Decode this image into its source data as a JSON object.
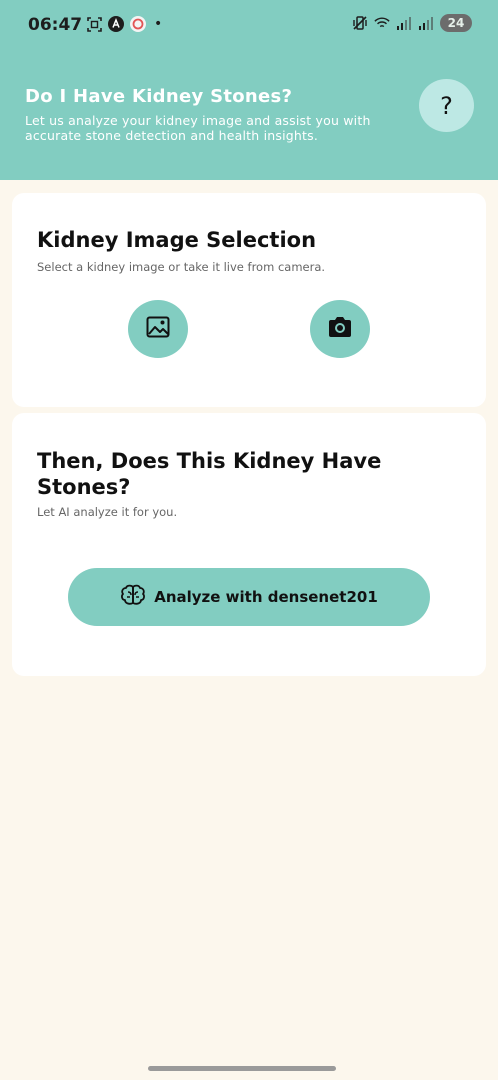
{
  "status_bar": {
    "time": "06:47",
    "battery": "24",
    "dot": "•"
  },
  "header": {
    "title": "Do I Have Kidney Stones?",
    "subtitle": "Let us analyze your kidney image and assist you with accurate stone detection and health insights.",
    "help_label": "?"
  },
  "selection_card": {
    "title": "Kidney Image Selection",
    "subtitle": "Select a kidney image or take it live from camera.",
    "gallery_icon": "image-icon",
    "camera_icon": "camera-icon"
  },
  "analyze_card": {
    "title": "Then, Does This Kidney Have Stones?",
    "subtitle": "Let AI analyze it for you.",
    "button_label": "Analyze with densenet201",
    "button_icon": "brain-icon"
  },
  "colors": {
    "accent": "#82cdc1",
    "background": "#fcf7ed",
    "help_bg": "#bde8e4"
  }
}
